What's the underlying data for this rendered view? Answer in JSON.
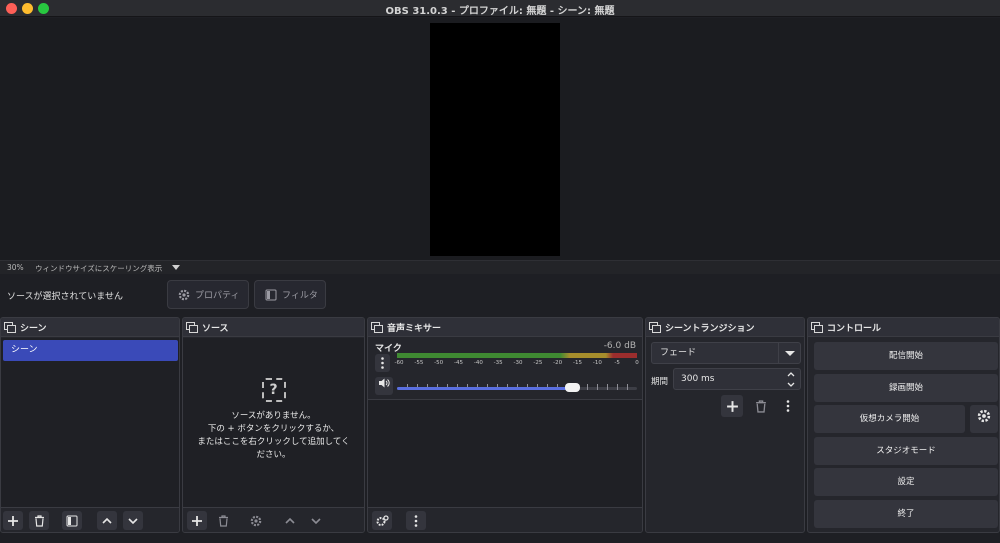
{
  "window": {
    "title": "OBS 31.0.3 - プロファイル: 無題 - シーン: 無題"
  },
  "preview": {
    "zoom": "30%",
    "scaling_mode": "ウィンドウサイズにスケーリング表示"
  },
  "context_bar": {
    "no_source_text": "ソースが選択されていません",
    "properties_label": "プロパティ",
    "filters_label": "フィルタ"
  },
  "docks": {
    "scenes": {
      "title": "シーン",
      "items": [
        {
          "label": "シーン",
          "selected": true
        }
      ]
    },
    "sources": {
      "title": "ソース",
      "empty_line1": "ソースがありません。",
      "empty_line2": "下の + ボタンをクリックするか、",
      "empty_line3": "またはここを右クリックして追加してく",
      "empty_line4": "ださい。"
    },
    "mixer": {
      "title": "音声ミキサー",
      "channels": [
        {
          "name": "マイク",
          "db": "-6.0 dB",
          "volume_fraction": 0.73
        }
      ],
      "ticks": [
        "-60",
        "-55",
        "-50",
        "-45",
        "-40",
        "-35",
        "-30",
        "-25",
        "-20",
        "-15",
        "-10",
        "-5",
        "0"
      ]
    },
    "transitions": {
      "title": "シーントランジション",
      "selected": "フェード",
      "duration_label": "期間",
      "duration_value": "300 ms"
    },
    "controls": {
      "title": "コントロール",
      "start_streaming": "配信開始",
      "start_recording": "録画開始",
      "start_virtual_camera": "仮想カメラ開始",
      "studio_mode": "スタジオモード",
      "settings": "設定",
      "exit": "終了"
    }
  },
  "colors": {
    "selected_scene": "#3a4ab8",
    "volume_fill": "#5a6fe0",
    "meter_green": "#3f8a32",
    "meter_yellow": "#a68d2c",
    "meter_red": "#9b2d2d"
  },
  "icons": [
    "plus-icon",
    "trash-icon",
    "filter-icon",
    "chevron-up-icon",
    "chevron-down-icon",
    "gear-icon",
    "kebab-menu-icon",
    "speaker-icon",
    "question-icon"
  ]
}
